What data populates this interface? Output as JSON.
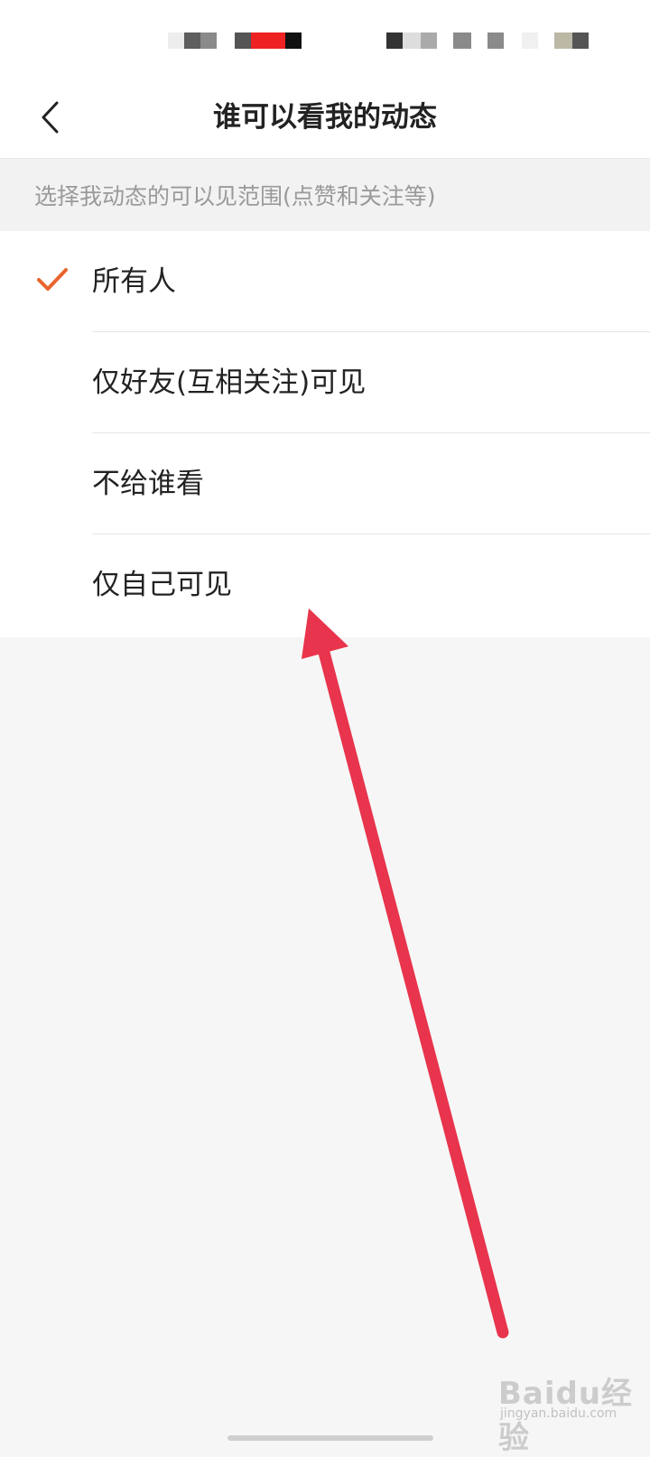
{
  "header": {
    "title": "谁可以看我的动态",
    "back_icon": "chevron-left-icon"
  },
  "hint": {
    "text": "选择我动态的可以见范围(点赞和关注等)"
  },
  "options": [
    {
      "label": "所有人",
      "selected": true
    },
    {
      "label": "仅好友(互相关注)可见",
      "selected": false
    },
    {
      "label": "不给谁看",
      "selected": false
    },
    {
      "label": "仅自己可见",
      "selected": false
    }
  ],
  "colors": {
    "accent": "#e8642c",
    "annotation_arrow": "#e8344c"
  },
  "watermark": {
    "text": "Baidu经验",
    "sub": "jingyan.baidu.com"
  }
}
